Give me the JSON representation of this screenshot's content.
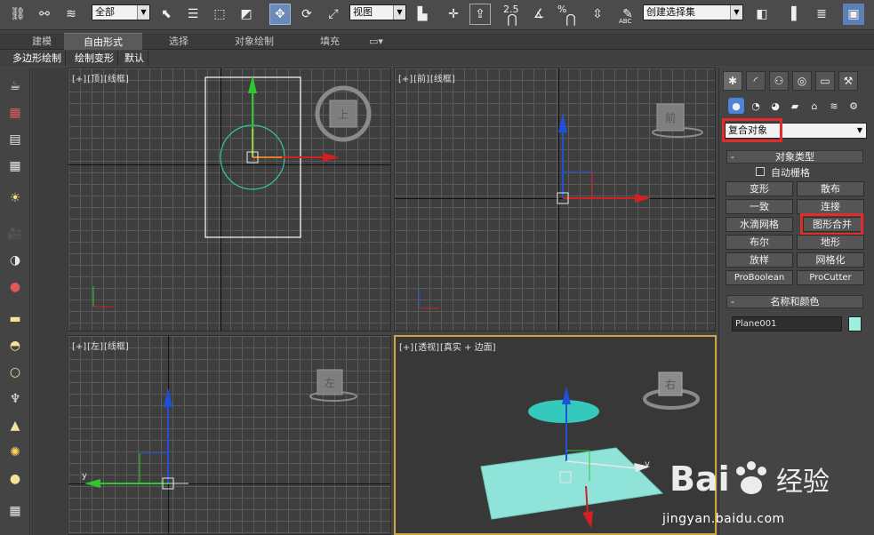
{
  "toolbar": {
    "selection_filter": "全部",
    "ref_coord": "视图",
    "snap_label": "2.5",
    "percent_label": "%",
    "abc_label": "ABC",
    "named_selection": "创建选择集",
    "icons": [
      "link-icon",
      "unlink-icon",
      "bind-spacewarp-icon",
      "select-object-icon",
      "select-by-name-icon",
      "rect-region-icon",
      "window-crossing-icon",
      "move-icon",
      "rotate-icon",
      "scale-icon",
      "pivot-icon",
      "manipulate-icon",
      "snap-icon",
      "angle-snap-icon",
      "percent-snap-icon",
      "spinner-snap-icon",
      "edit-named-icon",
      "mirror-icon",
      "align-icon",
      "layer-icon",
      "render-icon"
    ]
  },
  "ribbon": {
    "tabs": [
      {
        "label": "建模"
      },
      {
        "label": "自由形式",
        "active": true
      },
      {
        "label": "选择"
      },
      {
        "label": "对象绘制"
      },
      {
        "label": "填充"
      }
    ],
    "sub_tabs": [
      "多边形绘制",
      "绘制变形",
      "默认"
    ]
  },
  "viewports": {
    "top": {
      "bracket1": "[+]",
      "view": "[顶]",
      "shading": "[线框]",
      "cube_face": "上"
    },
    "front": {
      "bracket1": "[+]",
      "view": "[前]",
      "shading": "[线框]",
      "cube_face": "前"
    },
    "left": {
      "bracket1": "[+]",
      "view": "[左]",
      "shading": "[线框]",
      "cube_face": "左"
    },
    "perspective": {
      "bracket1": "[+]",
      "view": "[透视]",
      "shading": "[真实 + 边面]",
      "cube_face": "右"
    },
    "axis_labels": {
      "x": "x",
      "y": "y",
      "z": "z"
    }
  },
  "command_panel": {
    "category": "复合对象",
    "object_type_title": "对象类型",
    "auto_grid": "自动栅格",
    "buttons": [
      [
        "变形",
        "散布"
      ],
      [
        "一致",
        "连接"
      ],
      [
        "水滴网格",
        "图形合并"
      ],
      [
        "布尔",
        "地形"
      ],
      [
        "放样",
        "网格化"
      ],
      [
        "ProBoolean",
        "ProCutter"
      ]
    ],
    "name_color_title": "名称和颜色",
    "object_name": "Plane001",
    "object_color": "#9feee0",
    "minus": "-"
  },
  "watermark": {
    "brand_text": "Bai",
    "brand_suffix": "经验",
    "url": "jingyan.baidu.com"
  }
}
